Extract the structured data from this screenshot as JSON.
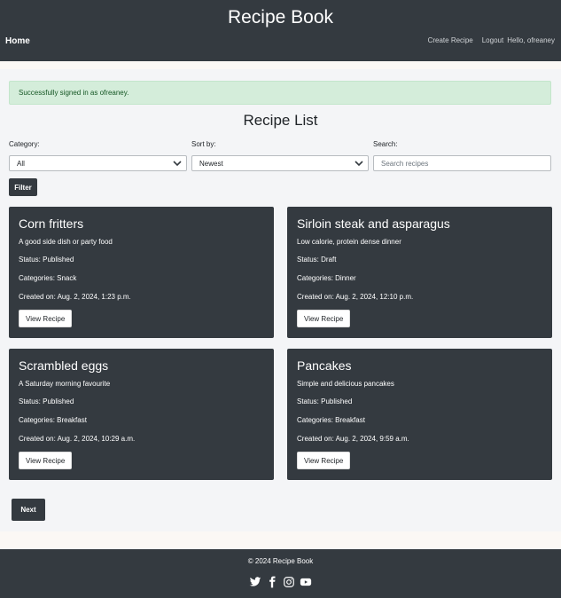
{
  "header": {
    "title": "Recipe Book",
    "home": "Home",
    "create": "Create Recipe",
    "logout": "Logout",
    "greeting": "Hello, ofreaney"
  },
  "alert": "Successfully signed in as ofreaney.",
  "page_title": "Recipe List",
  "filters": {
    "category_label": "Category:",
    "category_value": "All",
    "sort_label": "Sort by:",
    "sort_value": "Newest",
    "search_label": "Search:",
    "search_placeholder": "Search recipes",
    "filter_button": "Filter"
  },
  "recipes": [
    {
      "title": "Corn fritters",
      "description": "A good side dish or party food",
      "status": "Status: Published",
      "categories": "Categories: Snack",
      "created": "Created on: Aug. 2, 2024, 1:23 p.m.",
      "button": "View Recipe"
    },
    {
      "title": "Sirloin steak and asparagus",
      "description": "Low calorie, protein dense dinner",
      "status": "Status: Draft",
      "categories": "Categories: Dinner",
      "created": "Created on: Aug. 2, 2024, 12:10 p.m.",
      "button": "View Recipe"
    },
    {
      "title": "Scrambled eggs",
      "description": "A Saturday morning favourite",
      "status": "Status: Published",
      "categories": "Categories: Breakfast",
      "created": "Created on: Aug. 2, 2024, 10:29 a.m.",
      "button": "View Recipe"
    },
    {
      "title": "Pancakes",
      "description": "Simple and delicious pancakes",
      "status": "Status: Published",
      "categories": "Categories: Breakfast",
      "created": "Created on: Aug. 2, 2024, 9:59 a.m.",
      "button": "View Recipe"
    }
  ],
  "pagination": {
    "next": "Next"
  },
  "footer": {
    "copyright": "© 2024 Recipe Book",
    "social_icons": [
      "twitter-icon",
      "facebook-icon",
      "instagram-icon",
      "youtube-icon"
    ]
  },
  "colors": {
    "dark": "#343a40",
    "alert_bg": "#d4edda",
    "alert_text": "#155724"
  }
}
